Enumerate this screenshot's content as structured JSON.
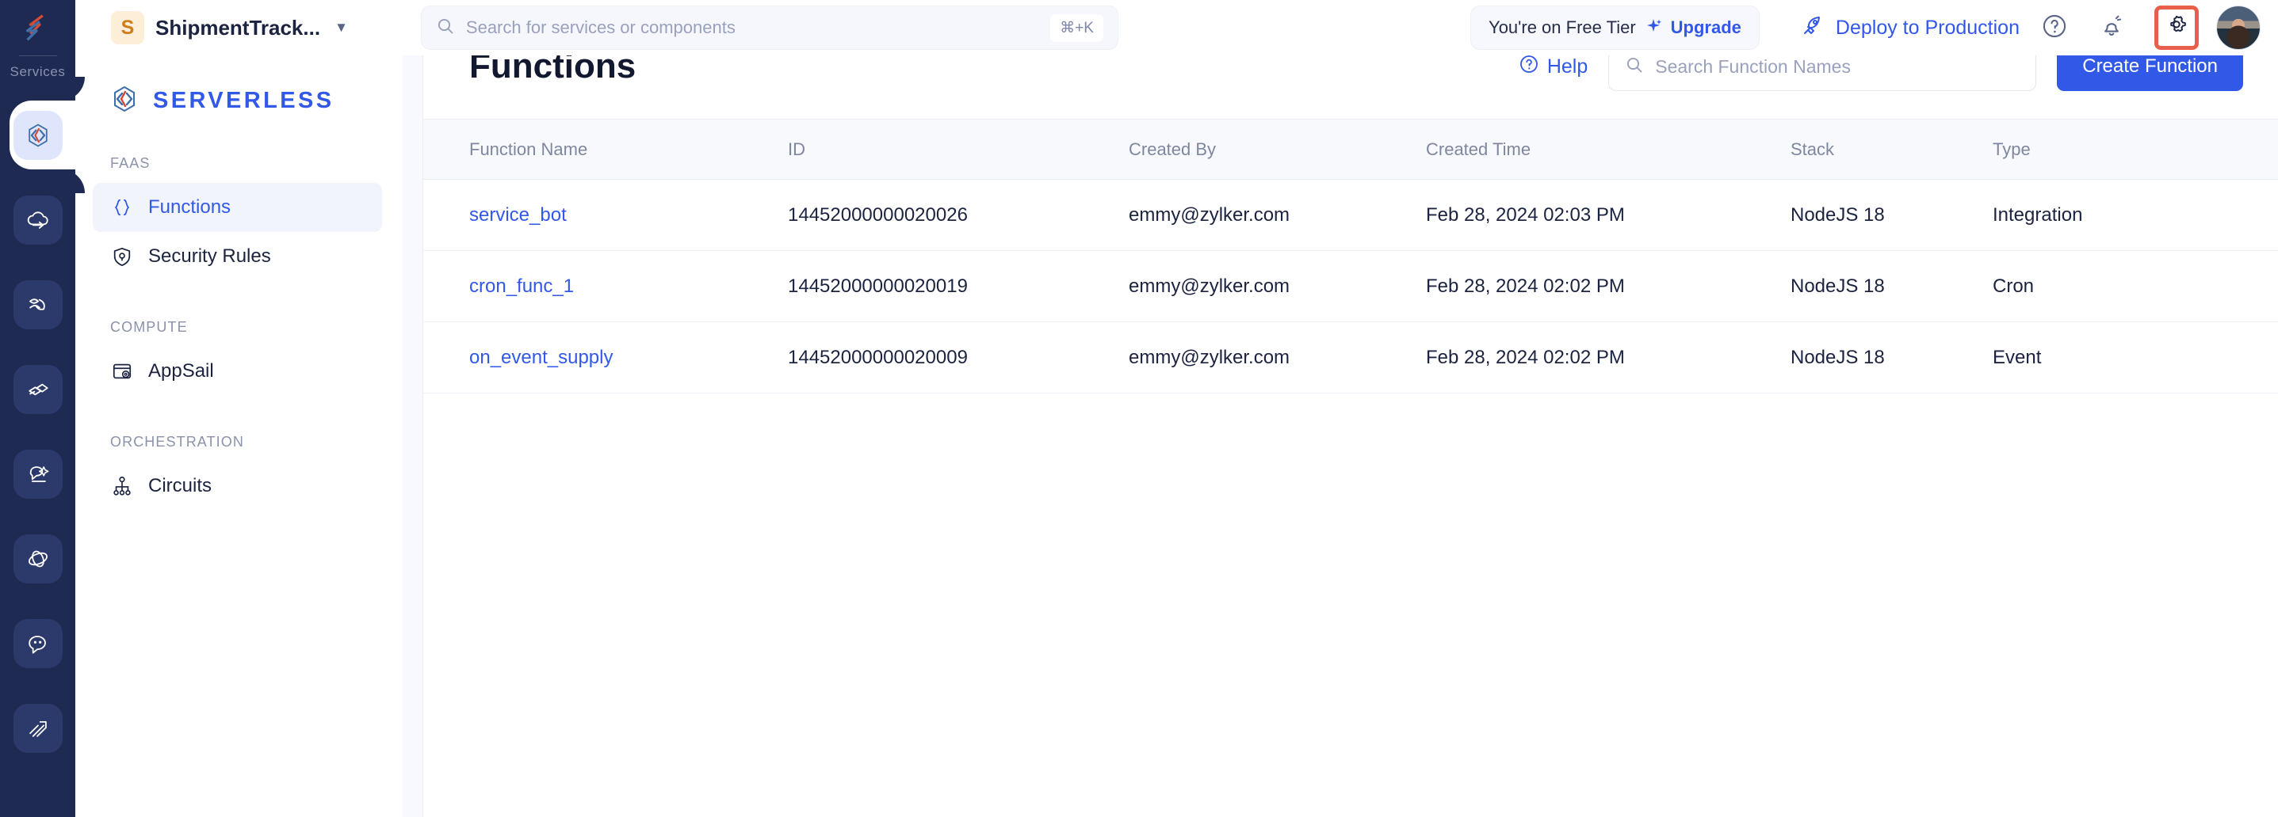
{
  "rail": {
    "label": "Services",
    "logo_icon": "zoho-catalyst-logo-icon",
    "items": [
      {
        "name": "serverless",
        "icon": "code-brackets-icon",
        "active": true
      },
      {
        "name": "cloud-scale",
        "icon": "cloud-arrow-icon",
        "active": false
      },
      {
        "name": "data-store",
        "icon": "data-flow-icon",
        "active": false
      },
      {
        "name": "integrations",
        "icon": "layers-icon",
        "active": false
      },
      {
        "name": "ai-services",
        "icon": "chat-spark-icon",
        "active": false
      },
      {
        "name": "orbit",
        "icon": "orbit-icon",
        "active": false
      },
      {
        "name": "conversations",
        "icon": "chat-smiley-icon",
        "active": false
      },
      {
        "name": "analytics",
        "icon": "trend-arrow-icon",
        "active": false
      }
    ]
  },
  "topbar": {
    "workspace_initial": "S",
    "workspace_name": "ShipmentTrack...",
    "workspace_caret_icon": "chevron-down-icon",
    "search": {
      "icon": "search-icon",
      "placeholder": "Search for services or components",
      "shortcut": "⌘+K"
    },
    "tier_text": "You're on Free Tier",
    "tier_upgrade_label": "Upgrade",
    "tier_upgrade_icon": "sparkle-icon",
    "deploy_label": "Deploy to Production",
    "deploy_icon": "rocket-icon",
    "help_icon": "question-circle-icon",
    "notifications_icon": "bell-icon",
    "settings_icon": "gear-icon",
    "settings_highlighted": true,
    "avatar_icon": "user-avatar-photo"
  },
  "sidebar": {
    "brand_name": "SERVERLESS",
    "brand_icon": "code-brackets-icon",
    "groups": [
      {
        "title": "FAAS",
        "items": [
          {
            "label": "Functions",
            "icon": "curly-braces-icon",
            "active": true
          },
          {
            "label": "Security Rules",
            "icon": "shield-lock-icon",
            "active": false
          }
        ]
      },
      {
        "title": "COMPUTE",
        "items": [
          {
            "label": "AppSail",
            "icon": "window-gear-icon",
            "active": false
          }
        ]
      },
      {
        "title": "ORCHESTRATION",
        "items": [
          {
            "label": "Circuits",
            "icon": "sitemap-icon",
            "active": false
          }
        ]
      }
    ]
  },
  "main": {
    "page_title": "Functions",
    "help_label": "Help",
    "help_icon": "question-circle-icon",
    "search": {
      "icon": "search-icon",
      "placeholder": "Search Function Names"
    },
    "create_button_label": "Create Function",
    "table": {
      "columns": [
        "Function Name",
        "ID",
        "Created By",
        "Created Time",
        "Stack",
        "Type"
      ],
      "rows": [
        {
          "name": "service_bot",
          "id": "14452000000020026",
          "created_by": "emmy@zylker.com",
          "created_time": "Feb 28, 2024 02:03 PM",
          "stack": "NodeJS 18",
          "type": "Integration"
        },
        {
          "name": "cron_func_1",
          "id": "14452000000020019",
          "created_by": "emmy@zylker.com",
          "created_time": "Feb 28, 2024 02:02 PM",
          "stack": "NodeJS 18",
          "type": "Cron"
        },
        {
          "name": "on_event_supply",
          "id": "14452000000020009",
          "created_by": "emmy@zylker.com",
          "created_time": "Feb 28, 2024 02:02 PM",
          "stack": "NodeJS 18",
          "type": "Event"
        }
      ]
    }
  },
  "colors": {
    "accent_blue": "#3258e8",
    "rail_navy": "#1e2a52",
    "highlight_red": "#e8604c",
    "logo_orange": "#cf7d1c"
  }
}
